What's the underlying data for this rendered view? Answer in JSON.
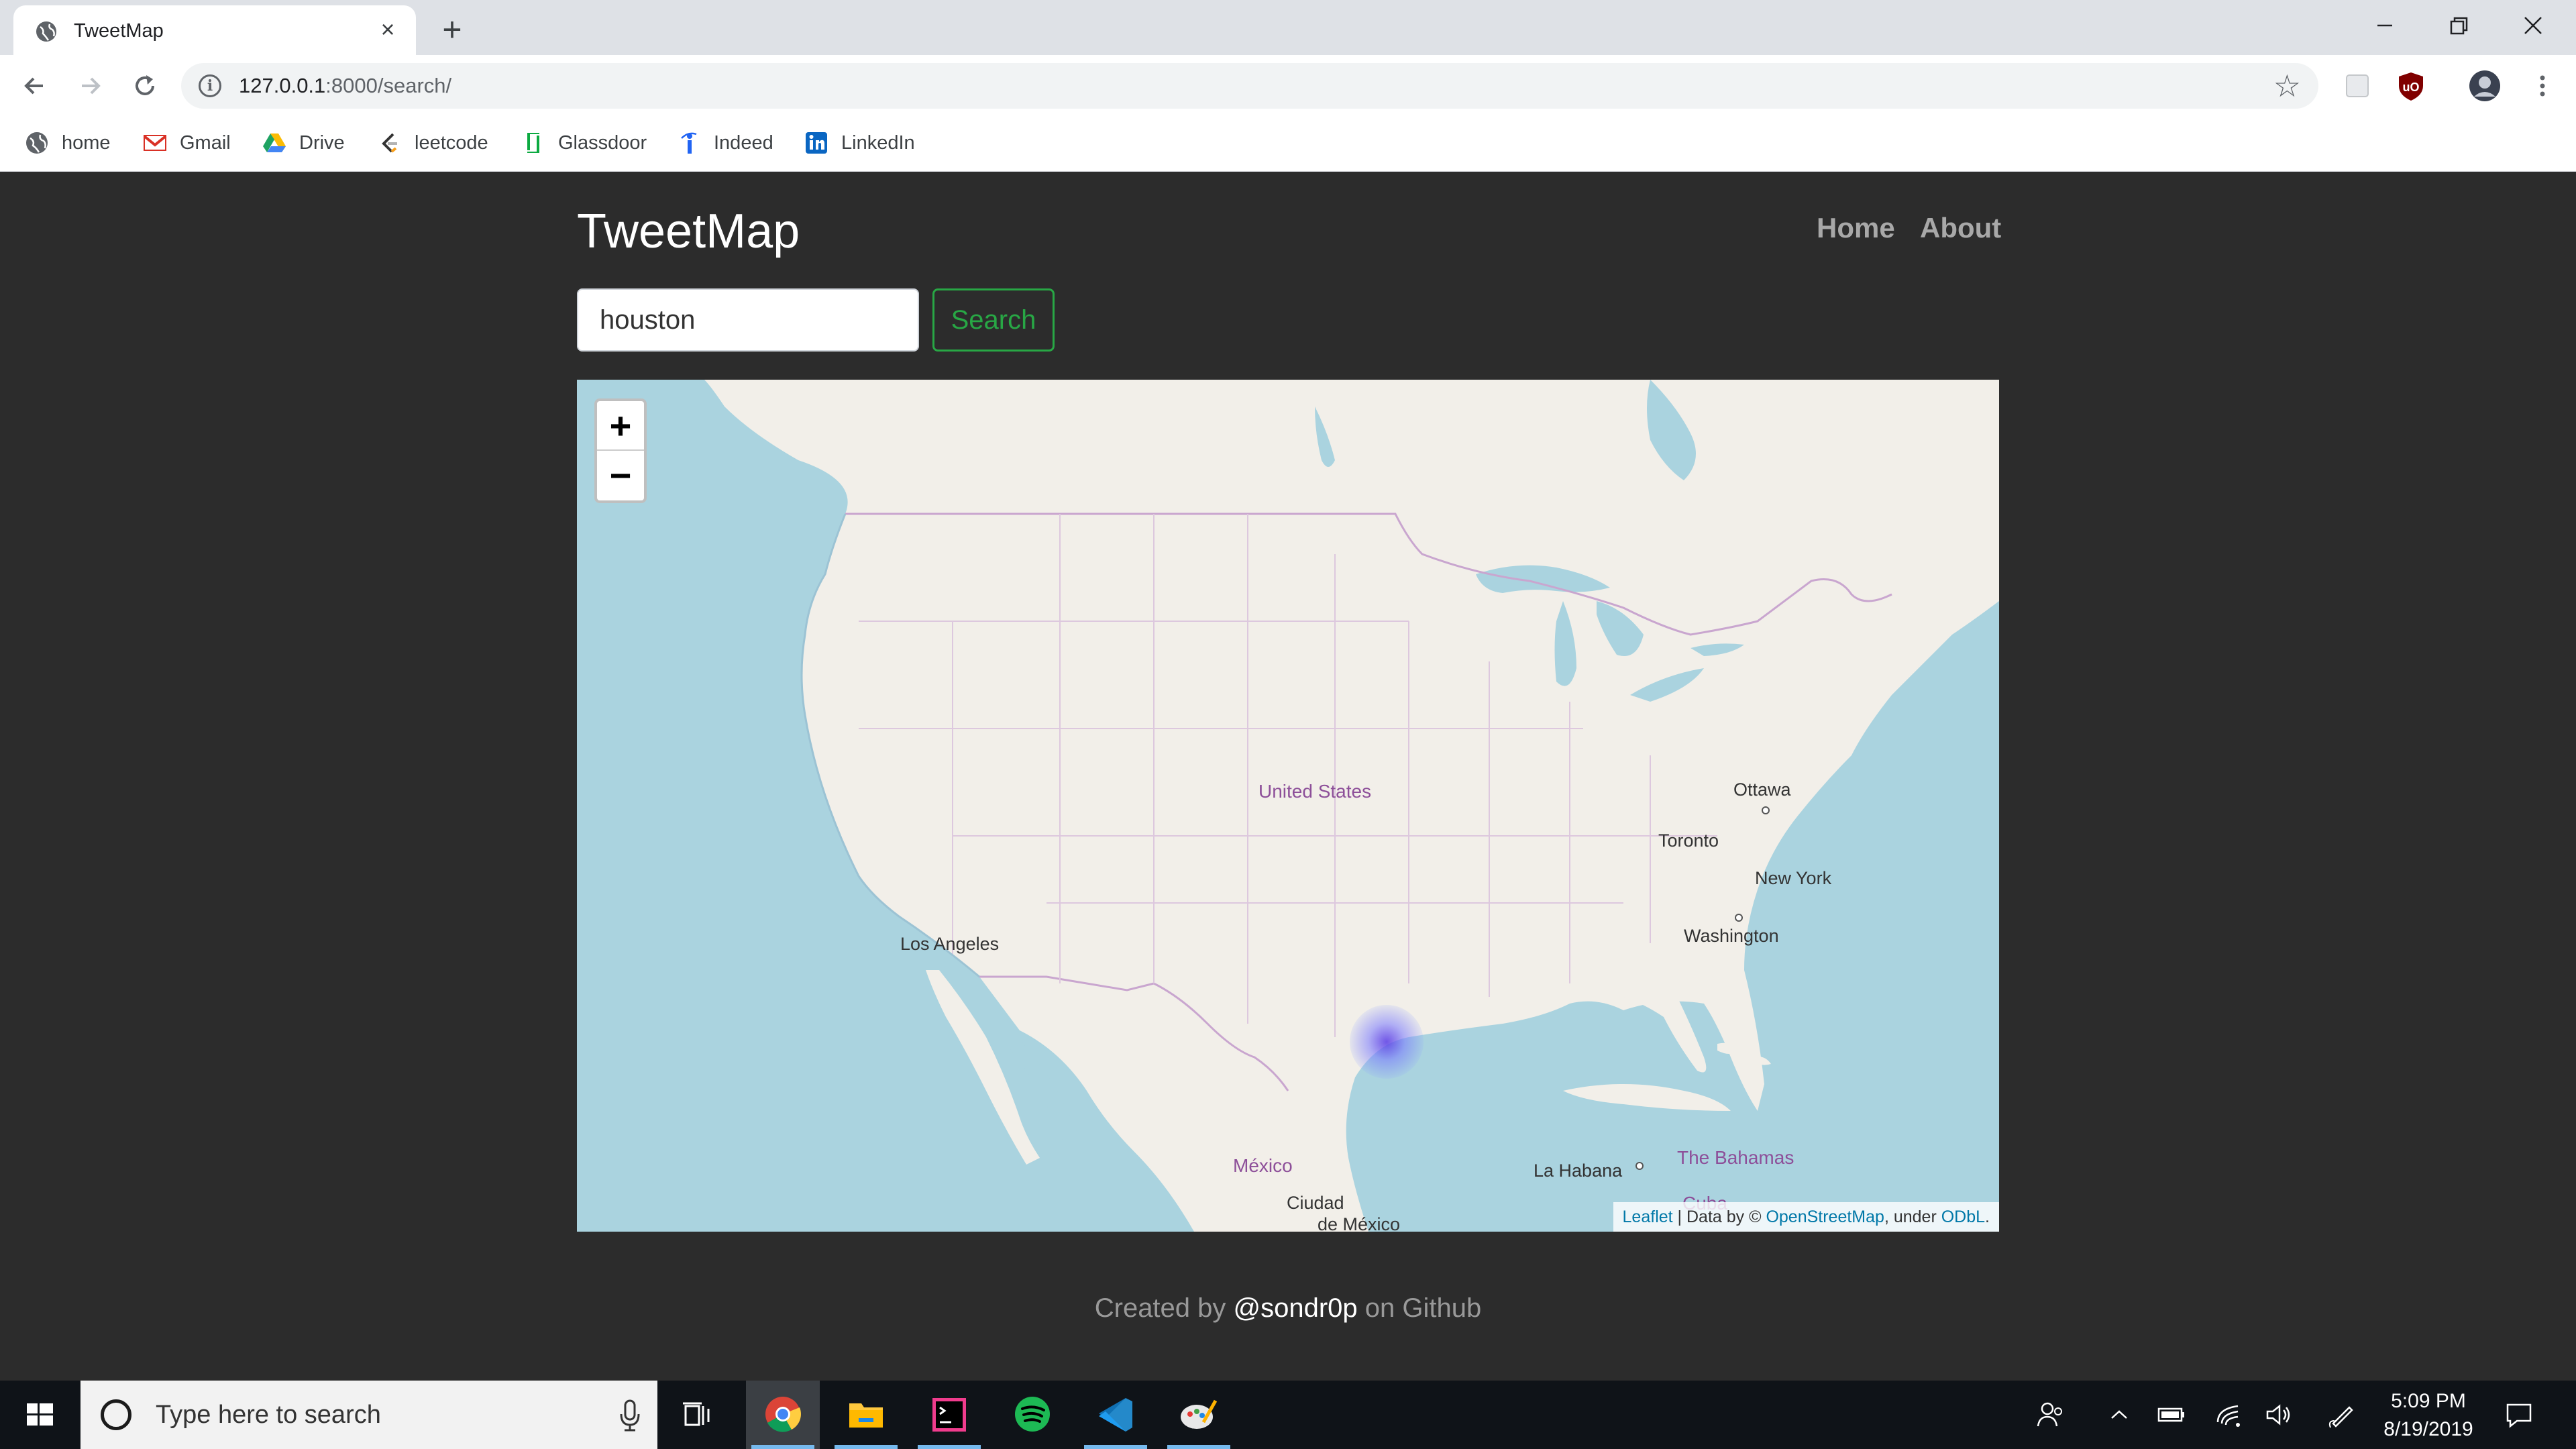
{
  "browser": {
    "tab_title": "TweetMap",
    "url_host": "127.0.0.1",
    "url_path": ":8000/search/",
    "bookmarks": [
      {
        "label": "home",
        "icon": "globe-icon"
      },
      {
        "label": "Gmail",
        "icon": "gmail-icon"
      },
      {
        "label": "Drive",
        "icon": "drive-icon"
      },
      {
        "label": "leetcode",
        "icon": "leetcode-icon"
      },
      {
        "label": "Glassdoor",
        "icon": "glassdoor-icon"
      },
      {
        "label": "Indeed",
        "icon": "indeed-icon"
      },
      {
        "label": "LinkedIn",
        "icon": "linkedin-icon"
      }
    ]
  },
  "site": {
    "brand": "TweetMap",
    "nav": {
      "home": "Home",
      "about": "About"
    },
    "search": {
      "value": "houston",
      "button": "Search"
    },
    "footer": {
      "prefix": "Created by ",
      "handle": "@sondr0p",
      "suffix": " on Github"
    }
  },
  "map": {
    "zoom_in": "+",
    "zoom_out": "−",
    "labels": {
      "united_states": "United States",
      "ottawa": "Ottawa",
      "toronto": "Toronto",
      "new_york": "New York",
      "washington": "Washington",
      "los_angeles": "Los Angeles",
      "mexico": "México",
      "ciudad": "Ciudad",
      "de_mexico": "de México",
      "la_habana": "La Habana",
      "bahamas": "The Bahamas",
      "cuba": "Cuba"
    },
    "attribution": {
      "leaflet": "Leaflet",
      "sep": " | Data by © ",
      "osm": "OpenStreetMap",
      "under": ", under ",
      "odbl": "ODbL",
      "end": "."
    },
    "colors": {
      "water": "#aad3df",
      "land": "#f2efe9",
      "border": "#c9a6cf",
      "heat": "#5a3ce6"
    }
  },
  "taskbar": {
    "search_placeholder": "Type here to search",
    "time": "5:09 PM",
    "date": "8/19/2019",
    "accent": "#76b9ed"
  }
}
